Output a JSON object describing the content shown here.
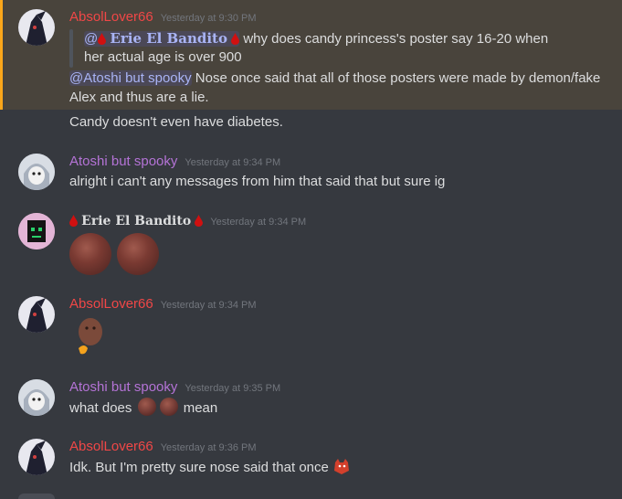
{
  "messages": {
    "m1": {
      "author": "AbsolLover66",
      "timestamp": "Yesterday at 9:30 PM",
      "reply_prefix": "@",
      "reply_name": "Erie El Bandito",
      "reply_text_1": " why does candy princess's poster say 16-20 when",
      "reply_text_2": "her actual age is over 900",
      "mention": "@Atoshi but spooky",
      "text_1": " Nose once said that all of those posters were made by demon/fake",
      "text_2": "Alex and thus are a lie.",
      "text_3": "Candy doesn't even have diabetes."
    },
    "m2": {
      "author": "Atoshi but spooky",
      "timestamp": "Yesterday at 9:34 PM",
      "text": "alright i can't any messages from him that said that but sure ig"
    },
    "m3": {
      "author": "Erie El Bandito",
      "timestamp": "Yesterday at 9:34 PM"
    },
    "m4": {
      "author": "AbsolLover66",
      "timestamp": "Yesterday at 9:34 PM"
    },
    "m5": {
      "author": "Atoshi but spooky",
      "timestamp": "Yesterday at 9:35 PM",
      "text_before": "what does ",
      "text_after": " mean"
    },
    "m6": {
      "author": "AbsolLover66",
      "timestamp": "Yesterday at 9:36 PM",
      "text": "Idk. But I'm pretty sure nose said that once "
    }
  },
  "colors": {
    "absol": "#f04747",
    "atoshi": "#b473d6",
    "erie": "#dcddde",
    "highlight_bar": "#faa61a",
    "background": "#36393f"
  },
  "icons": {
    "corner": "add-reaction-icon",
    "drop": "blood-drop-icon"
  }
}
